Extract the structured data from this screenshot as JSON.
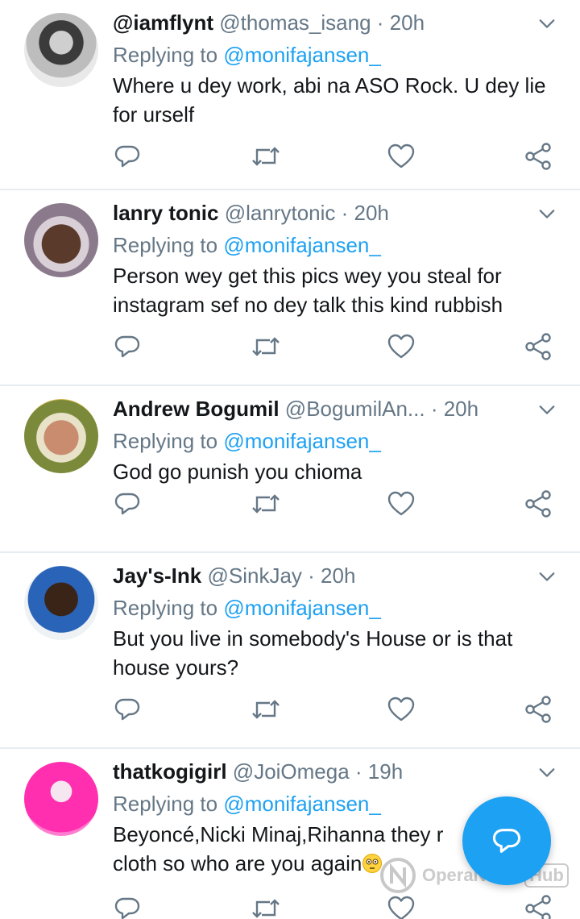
{
  "replying_label": "Replying to",
  "tweets": [
    {
      "name": "@iamflynt",
      "handle": "@thomas_isang · 20h",
      "reply_to": "@monifajansen_",
      "text": "Where u dey work, abi na ASO Rock. U dey lie for urself"
    },
    {
      "name": "lanry tonic",
      "handle": "@lanrytonic · 20h",
      "reply_to": "@monifajansen_",
      "text": "Person wey get this pics wey you steal for instagram sef no dey talk this kind rubbish"
    },
    {
      "name": "Andrew Bogumil",
      "handle": "@BogumilAn...  · 20h",
      "reply_to": "@monifajansen_",
      "text": "God go punish you chioma"
    },
    {
      "name": "Jay's-Ink",
      "handle": "@SinkJay · 20h",
      "reply_to": "@monifajansen_",
      "text": "But you live in somebody's House or is that house yours?"
    },
    {
      "name": "thatkogigirl",
      "handle": "@JoiOmega · 19h",
      "reply_to": "@monifajansen_",
      "text_line1": "Beyoncé,Nicki Minaj,Rihanna they r",
      "text_line2": "cloth so who are you again"
    }
  ],
  "icons": {
    "reply": "reply-icon",
    "retweet": "retweet-icon",
    "like": "heart-icon",
    "share": "share-icon",
    "more": "chevron-down-icon",
    "compose": "compose-reply-icon"
  },
  "colors": {
    "accent": "#1da1f2",
    "text": "#14171a",
    "muted": "#657786",
    "divider": "#e6ecf0"
  },
  "watermark": {
    "brand": "OperaNews",
    "hub": "Hub"
  }
}
